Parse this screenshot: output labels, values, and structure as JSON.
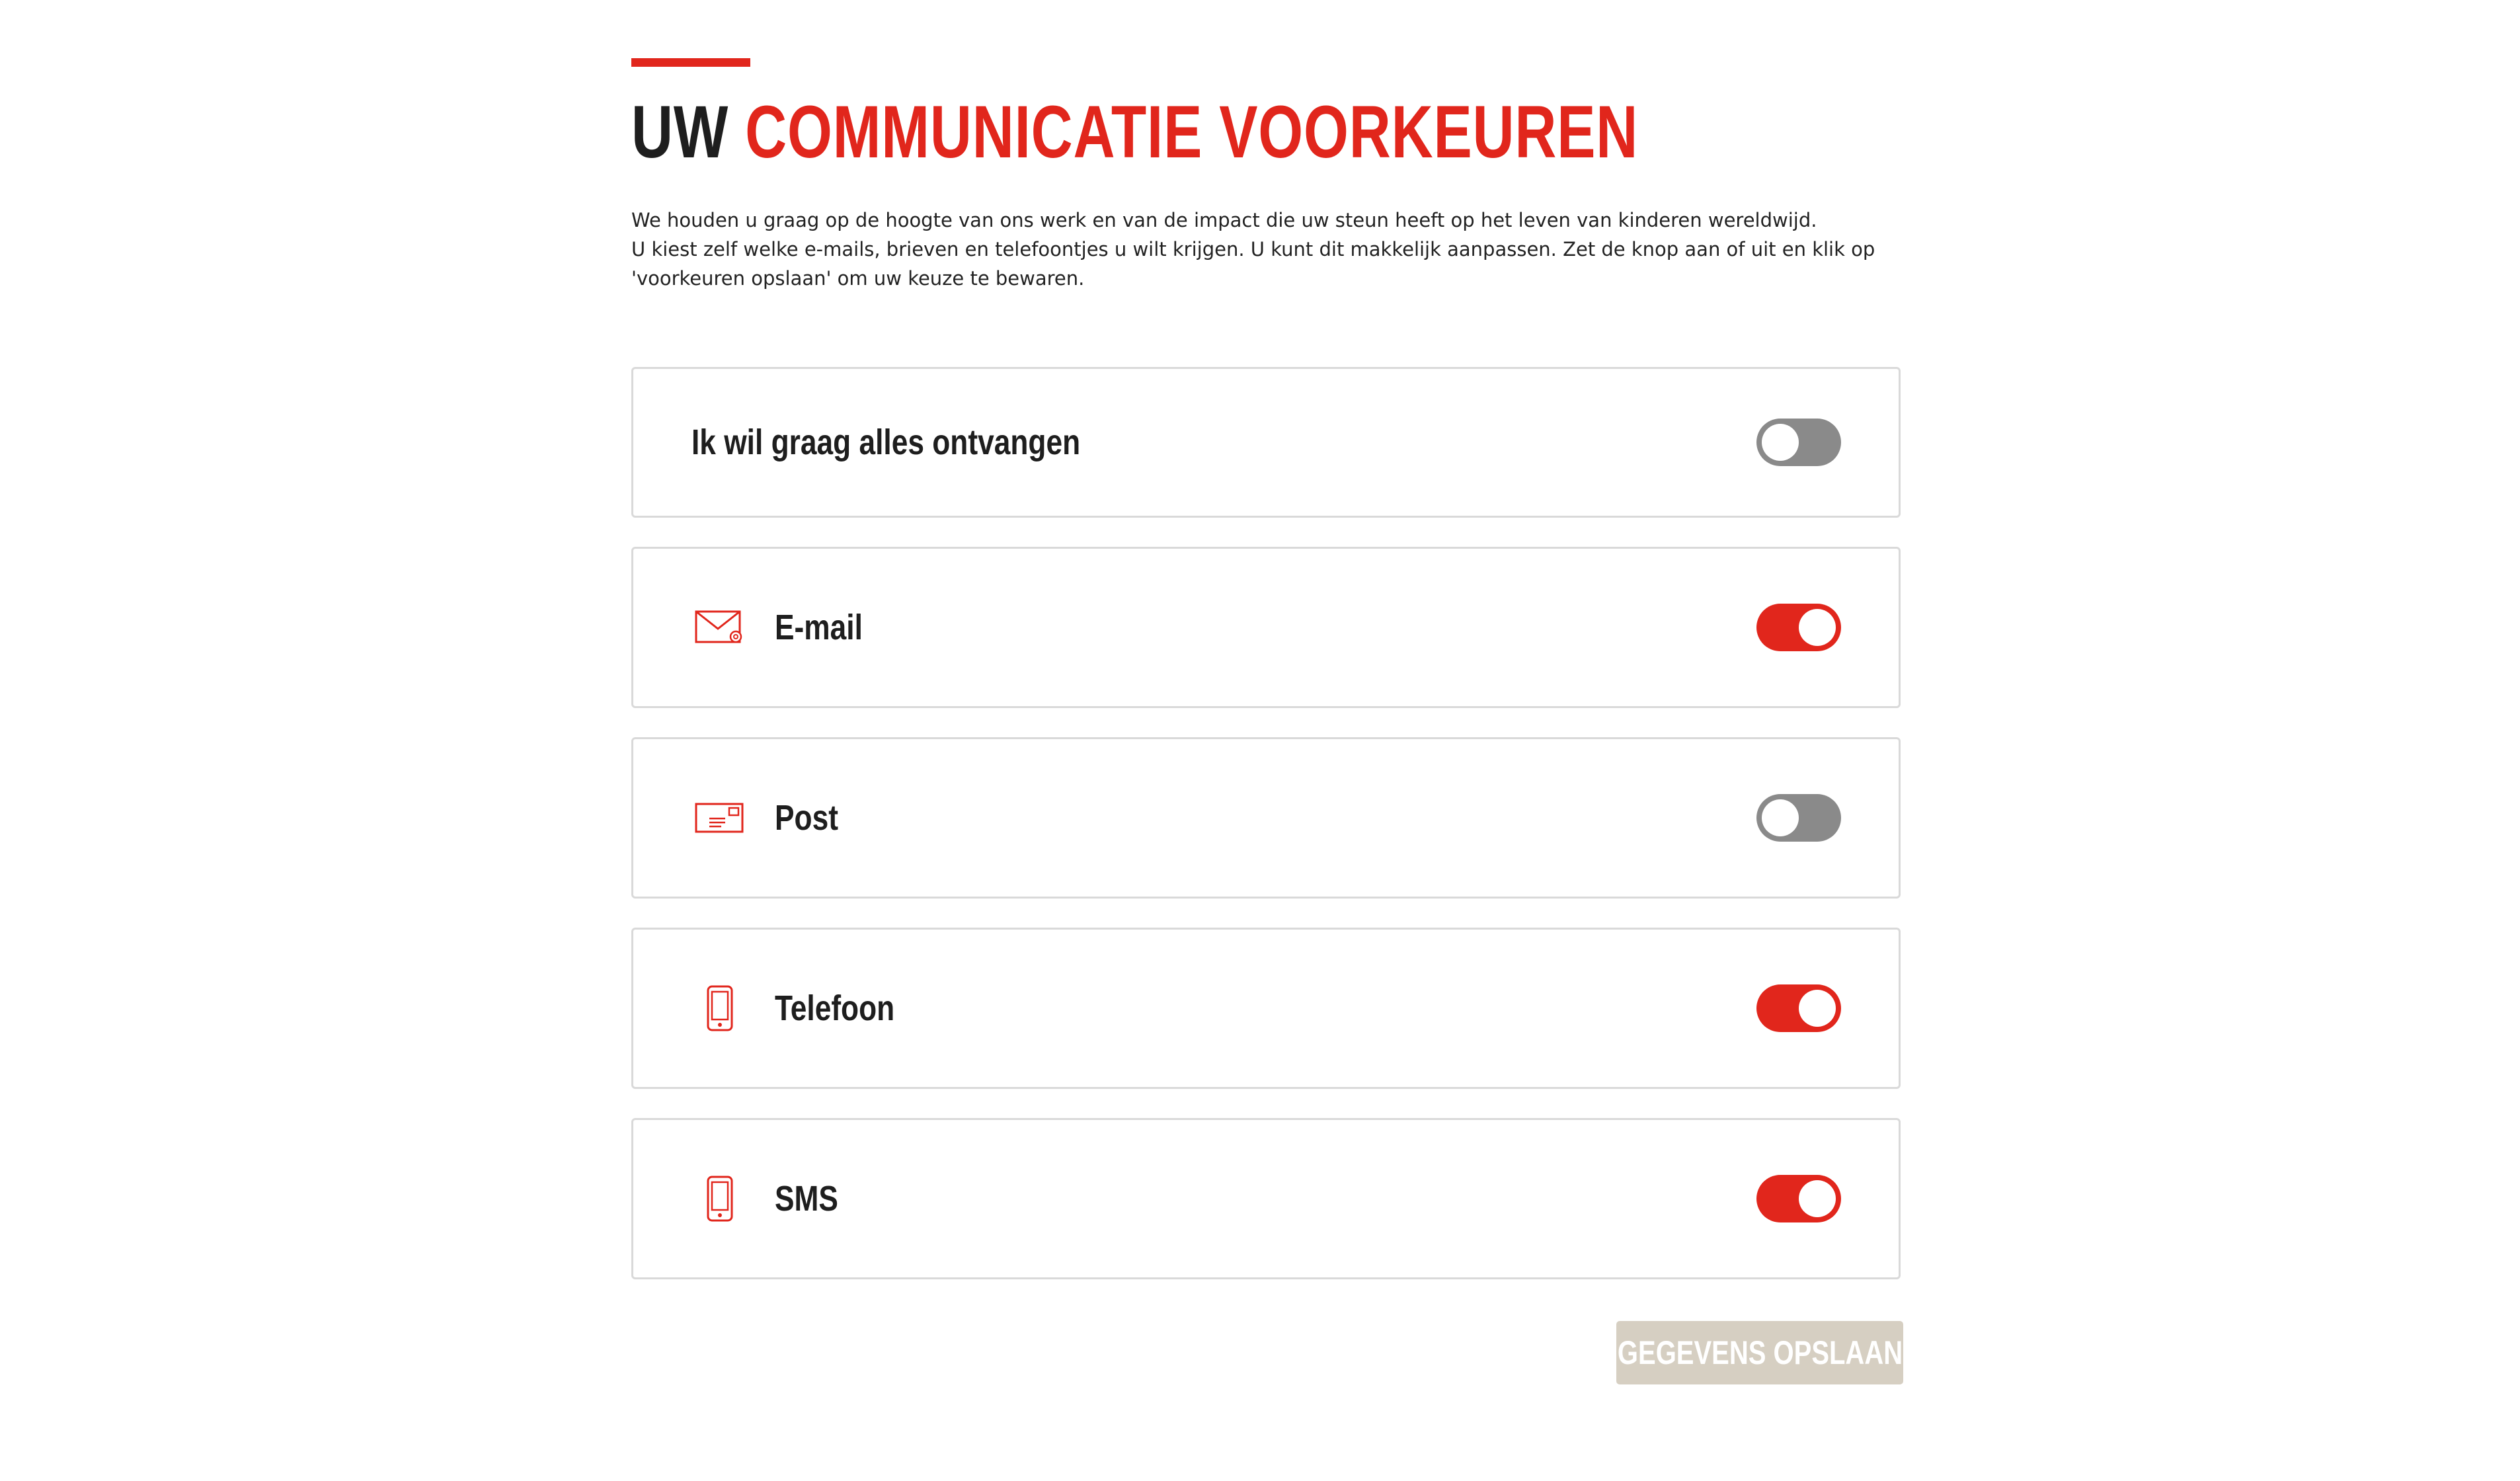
{
  "header": {
    "title_part1": "UW",
    "title_part2": "COMMUNICATIE VOORKEUREN"
  },
  "intro": {
    "line1": "We houden u graag op de hoogte van ons werk en van de impact die uw steun heeft op het leven van kinderen wereldwijd.",
    "line2": "U kiest zelf welke e-mails, brieven en telefoontjes u wilt krijgen. U kunt dit makkelijk aanpassen. Zet de knop aan of uit en klik op 'voorkeuren opslaan' om uw keuze te bewaren."
  },
  "preferences": {
    "all": {
      "label": "Ik wil graag alles ontvangen",
      "enabled": false
    },
    "items": [
      {
        "label": "E-mail",
        "icon": "envelope-icon",
        "enabled": true
      },
      {
        "label": "Post",
        "icon": "letter-icon",
        "enabled": false
      },
      {
        "label": "Telefoon",
        "icon": "phone-icon",
        "enabled": true
      },
      {
        "label": "SMS",
        "icon": "phone-icon",
        "enabled": true
      }
    ]
  },
  "actions": {
    "save_label": "GEGEVENS OPSLAAN"
  },
  "colors": {
    "accent": "#e1261c",
    "toggle_off": "#8a8a8a",
    "button_disabled": "#d6cfc2"
  }
}
